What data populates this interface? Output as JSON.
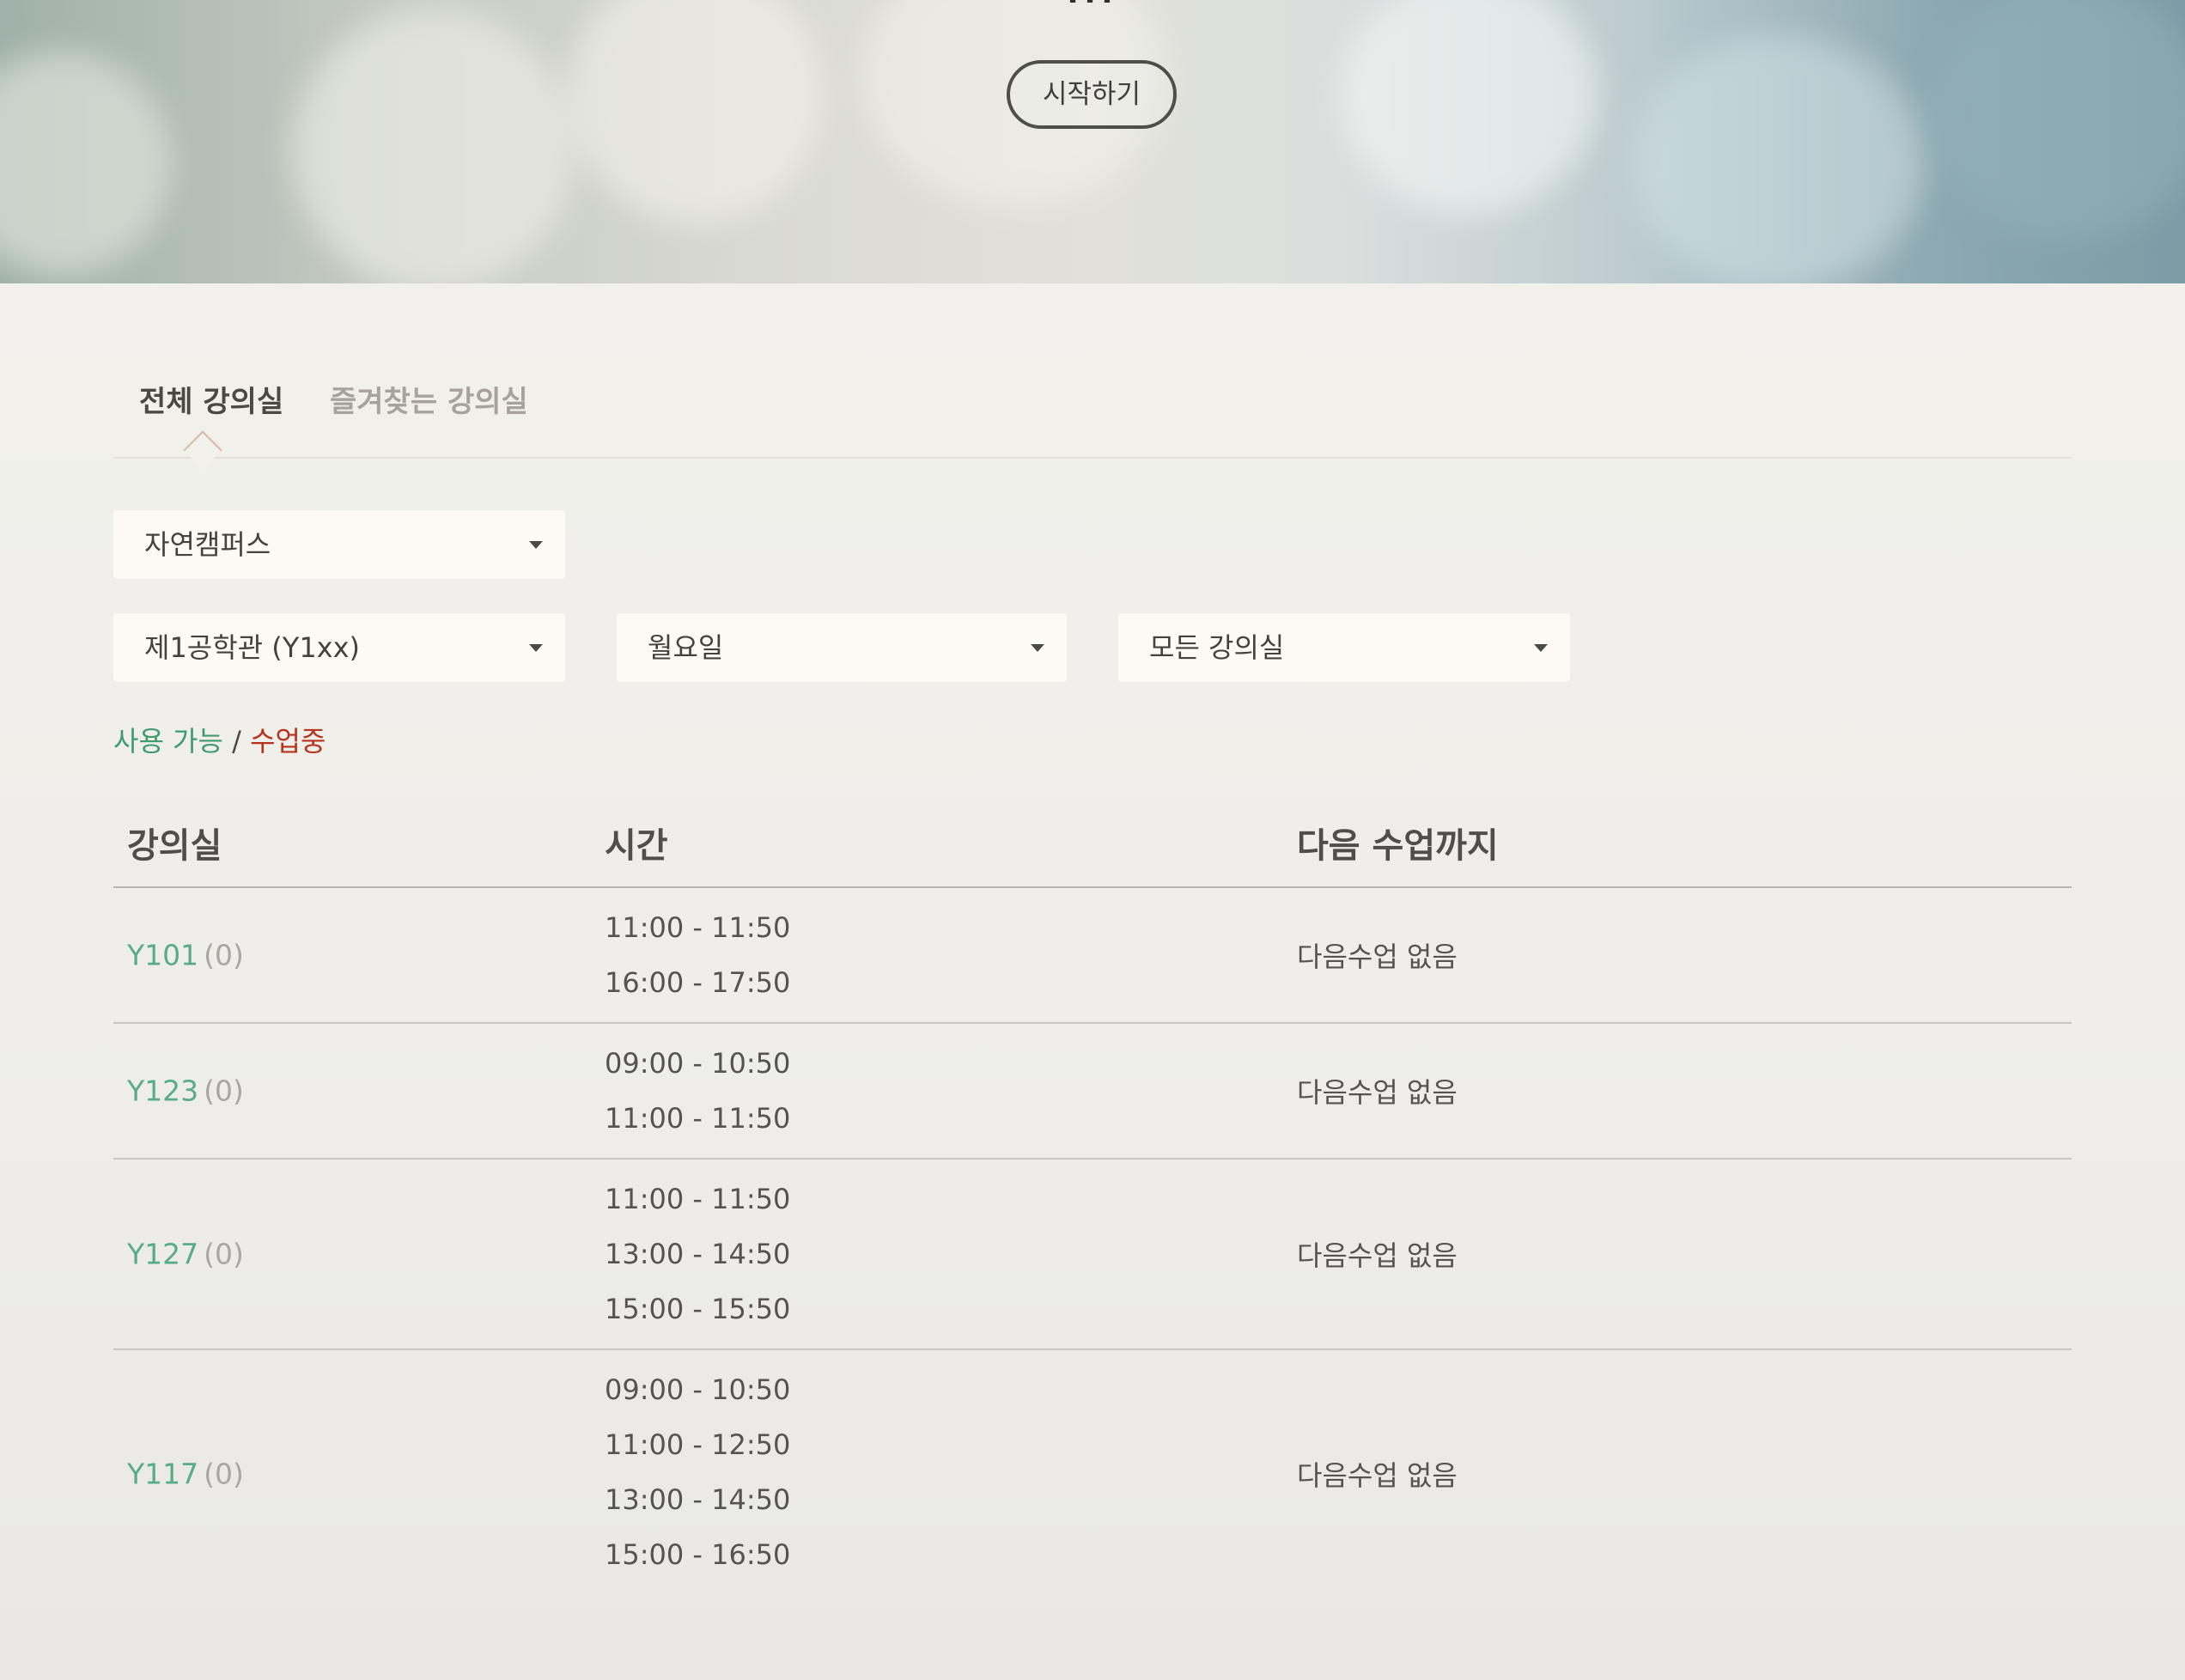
{
  "hero": {
    "title_fragment": "…  ",
    "start_button": "시작하기"
  },
  "tabs": {
    "all": "전체 강의실",
    "favorites": "즐겨찾는 강의실"
  },
  "filters": {
    "campus": "자연캠퍼스",
    "building": "제1공학관 (Y1xx)",
    "day": "월요일",
    "room": "모든 강의실"
  },
  "legend": {
    "available": "사용 가능",
    "separator": " / ",
    "in_class": "수업중"
  },
  "table": {
    "headers": {
      "room": "강의실",
      "time": "시간",
      "next": "다음 수업까지"
    },
    "rows": [
      {
        "room": "Y101",
        "count": "(0)",
        "times": [
          "11:00 - 11:50",
          "16:00 - 17:50"
        ],
        "next": "다음수업 없음"
      },
      {
        "room": "Y123",
        "count": "(0)",
        "times": [
          "09:00 - 10:50",
          "11:00 - 11:50"
        ],
        "next": "다음수업 없음"
      },
      {
        "room": "Y127",
        "count": "(0)",
        "times": [
          "11:00 - 11:50",
          "13:00 - 14:50",
          "15:00 - 15:50"
        ],
        "next": "다음수업 없음"
      },
      {
        "room": "Y117",
        "count": "(0)",
        "times": [
          "09:00 - 10:50",
          "11:00 - 12:50",
          "13:00 - 14:50",
          "15:00 - 16:50"
        ],
        "next": "다음수업 없음"
      }
    ]
  },
  "colors": {
    "available": "#3f9b70",
    "in_class": "#b6331c",
    "room_link": "#59ad86"
  }
}
